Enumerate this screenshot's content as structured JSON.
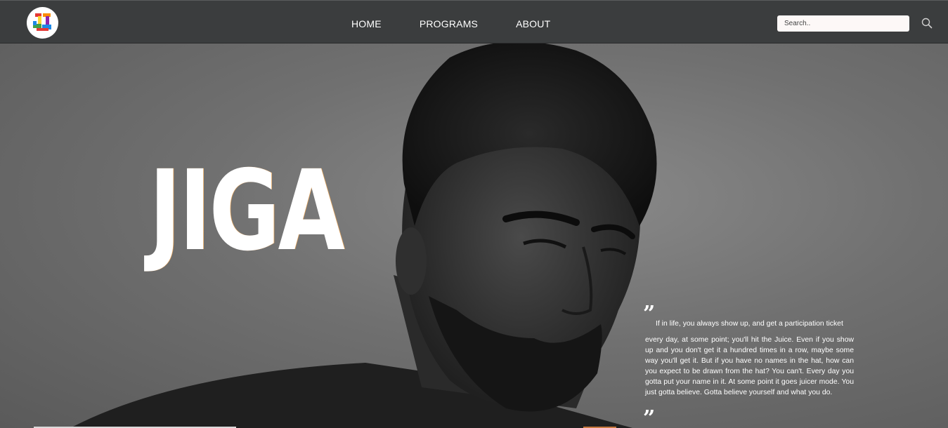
{
  "header": {
    "logo_icon": "jiga-logo-icon",
    "nav": [
      "HOME",
      "PROGRAMS",
      "ABOUT"
    ],
    "search": {
      "placeholder": "Search..",
      "value": ""
    },
    "search_icon": "search-icon"
  },
  "hero": {
    "title": "JIGA",
    "quote_open_mark": "”",
    "quote_close_mark": "”",
    "quote_line1": "If in life, you always show up, and get a participation ticket",
    "quote_rest": "every day, at some point; you'll hit the Juice. Even if you show up and you don't get it a hundred times in a row, maybe some way you'll get it. But if you have no names in the hat, how can you expect to be drawn from the hat? You can't. Every day you gotta put your name in it. At some point it goes juicer mode. You just gotta believe. Gotta believe yourself and what you do."
  },
  "colors": {
    "navbar": "#3b3d3e",
    "search_bg": "#fdf8f7",
    "accent_orange": "#c7783e"
  }
}
